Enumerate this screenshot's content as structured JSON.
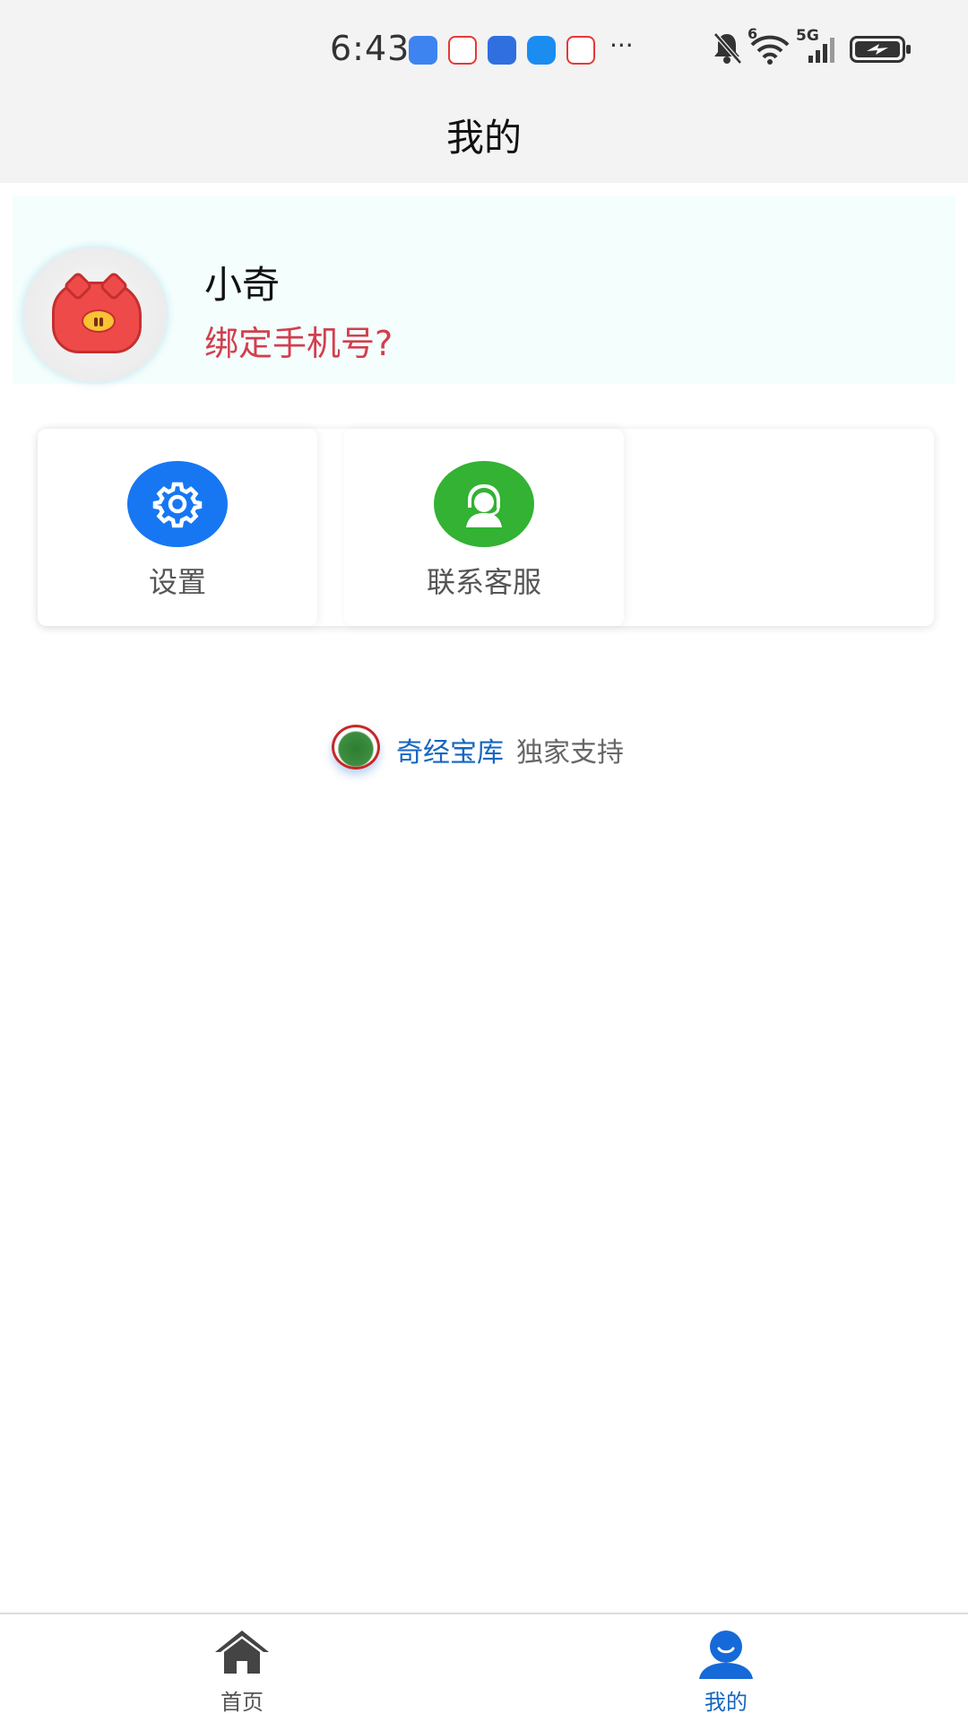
{
  "status_bar": {
    "time": "6:43",
    "more": "···",
    "signal_label": "5G",
    "wifi_label": "6",
    "icons": [
      "usb-icon",
      "app-notification-icon",
      "app-notification-icon",
      "message-icon",
      "app-notification-icon",
      "bell-muted-icon",
      "wifi-icon",
      "signal-icon",
      "battery-charging-icon"
    ]
  },
  "header": {
    "title": "我的"
  },
  "profile": {
    "name": "小奇",
    "bind_phone": "绑定手机号?"
  },
  "menu": {
    "items": [
      {
        "label": "设置",
        "icon": "gear-icon",
        "color": "#1777f2"
      },
      {
        "label": "联系客服",
        "icon": "customer-service-icon",
        "color": "#33b233"
      }
    ]
  },
  "powered_by": {
    "brand": "奇经宝库",
    "suffix": "独家支持"
  },
  "tabbar": {
    "items": [
      {
        "label": "首页",
        "icon": "home-icon",
        "active": false
      },
      {
        "label": "我的",
        "icon": "user-icon",
        "active": true
      }
    ],
    "active_color": "#1565c0"
  }
}
